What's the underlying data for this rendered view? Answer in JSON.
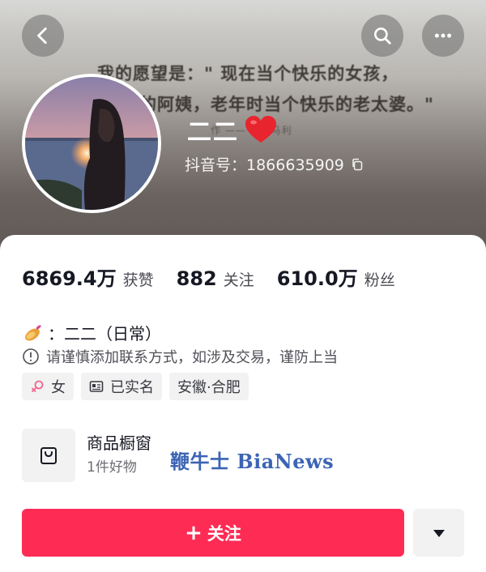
{
  "header": {
    "cover_text_line1": "我的愿望是：\" 现在当个快乐的女孩，",
    "cover_text_line2": "乐的阿姨，老年时当个快乐的老太婆。\"",
    "cover_text_faint": "作 —— 蒙哥马利",
    "nickname": "二二",
    "heart_icon": "red-heart-icon",
    "douyin_id": "抖音号：1866635909"
  },
  "stats": [
    {
      "value": "6869.4万",
      "label": "获赞"
    },
    {
      "value": "882",
      "label": "关注"
    },
    {
      "value": "610.0万",
      "label": "粉丝"
    }
  ],
  "bio": {
    "text": "：二二（日常）",
    "warning": "请谨慎添加联系方式，如涉及交易，谨防上当"
  },
  "tags": [
    {
      "label": "女",
      "icon": "female-icon"
    },
    {
      "label": "已实名",
      "icon": "id-card-icon"
    },
    {
      "label": "安徽·合肥",
      "icon": ""
    }
  ],
  "shop": {
    "title": "商品橱窗",
    "subtitle": "1件好物"
  },
  "watermark": "鞭牛士 BiaNews",
  "actions": {
    "follow_label": "关注",
    "follow_plus": "+"
  },
  "colors": {
    "accent": "#fe2c55",
    "tag_bg": "#f2f2f3",
    "watermark": "#3c64b4"
  }
}
